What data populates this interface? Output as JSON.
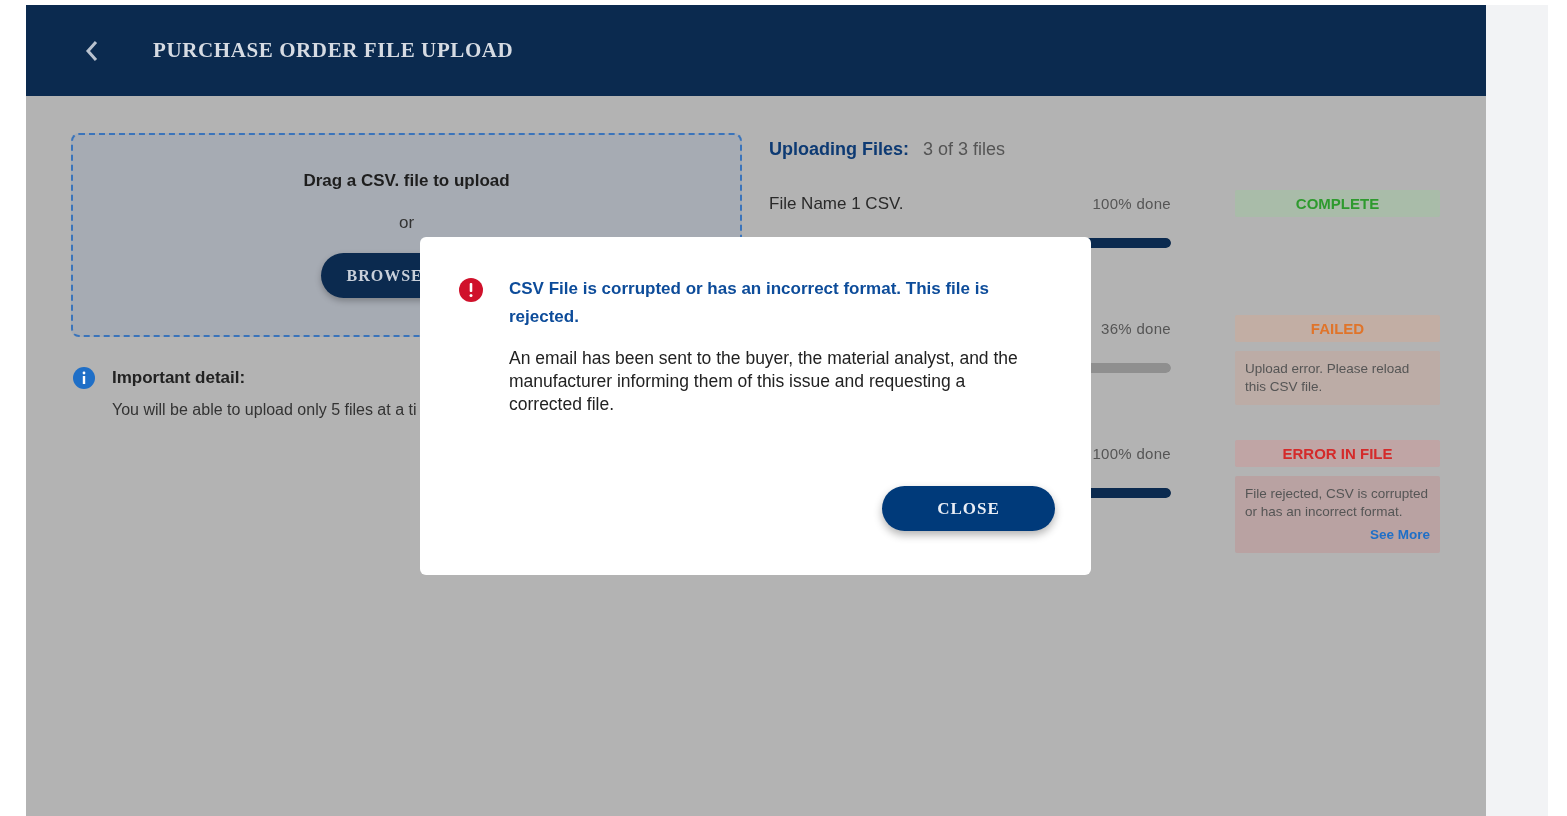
{
  "header": {
    "title": "PURCHASE ORDER FILE UPLOAD"
  },
  "dropzone": {
    "prompt": "Drag a CSV. file to upload",
    "separator": "or",
    "button": "BROWSE"
  },
  "note": {
    "title": "Important detail:",
    "text": "You will be able to upload only 5 files at a ti"
  },
  "uploads": {
    "title": "Uploading Files:",
    "count": "3 of 3 files",
    "files": [
      {
        "name": "File Name 1 CSV.",
        "progress": "100% done",
        "level": 1,
        "status": {
          "kind": "complete",
          "label": "COMPLETE"
        }
      },
      {
        "progress": "36% done",
        "status": {
          "kind": "failed",
          "label": "FAILED"
        },
        "message": "Upload error. Please reload this CSV file."
      },
      {
        "progress": "100% done",
        "level": 1,
        "status": {
          "kind": "error",
          "label": "ERROR IN FILE"
        },
        "message": "File rejected, CSV is corrupted or has an incorrect format.",
        "link": "See More"
      }
    ]
  },
  "dialog": {
    "title": "CSV File is corrupted or has an incorrect format. This file is rejected.",
    "body": "An email has been sent to the buyer, the material analyst, and the manufacturer informing them of this issue and requesting a corrected file.",
    "button": "CLOSE"
  }
}
